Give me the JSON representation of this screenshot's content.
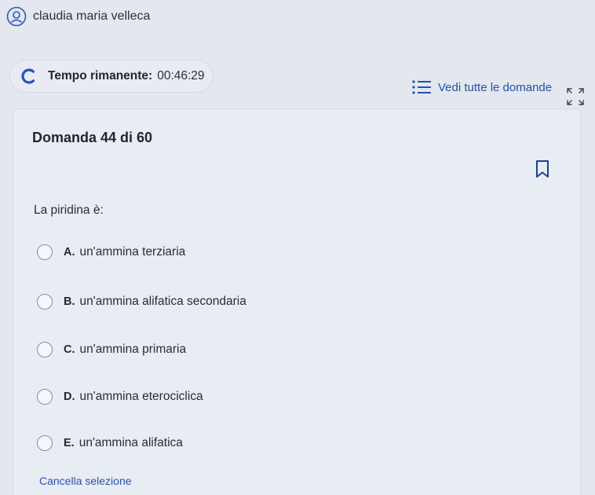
{
  "user": {
    "name": "claudia maria velleca",
    "icon": "user-avatar-icon"
  },
  "timer": {
    "label": "Tempo rimanente:",
    "value": "00:46:29",
    "icon": "spinner-icon"
  },
  "navigation": {
    "all_questions_label": "Vedi tutte le domande",
    "list_icon": "list-icon",
    "expand_icon": "expand-icon"
  },
  "question": {
    "title": "Domanda 44 di 60",
    "text": "La piridina è:",
    "bookmark_icon": "bookmark-icon",
    "options": [
      {
        "letter": "A.",
        "text": "un'ammina terziaria"
      },
      {
        "letter": "B.",
        "text": "un'ammina alifatica secondaria"
      },
      {
        "letter": "C.",
        "text": "un'ammina primaria"
      },
      {
        "letter": "D.",
        "text": "un'ammina eterociclica"
      },
      {
        "letter": "E.",
        "text": "un'ammina alifatica"
      }
    ],
    "clear_label": "Cancella selezione"
  },
  "colors": {
    "accent": "#2352a6",
    "background": "#e3e7ee",
    "card": "#e8ecf3"
  }
}
